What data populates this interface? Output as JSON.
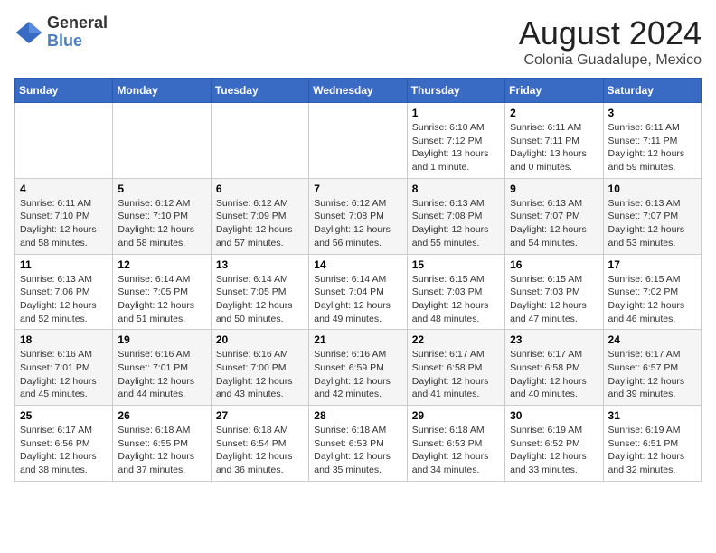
{
  "header": {
    "logo_general": "General",
    "logo_blue": "Blue",
    "month_year": "August 2024",
    "location": "Colonia Guadalupe, Mexico"
  },
  "weekdays": [
    "Sunday",
    "Monday",
    "Tuesday",
    "Wednesday",
    "Thursday",
    "Friday",
    "Saturday"
  ],
  "weeks": [
    [
      {
        "day": "",
        "info": ""
      },
      {
        "day": "",
        "info": ""
      },
      {
        "day": "",
        "info": ""
      },
      {
        "day": "",
        "info": ""
      },
      {
        "day": "1",
        "info": "Sunrise: 6:10 AM\nSunset: 7:12 PM\nDaylight: 13 hours\nand 1 minute."
      },
      {
        "day": "2",
        "info": "Sunrise: 6:11 AM\nSunset: 7:11 PM\nDaylight: 13 hours\nand 0 minutes."
      },
      {
        "day": "3",
        "info": "Sunrise: 6:11 AM\nSunset: 7:11 PM\nDaylight: 12 hours\nand 59 minutes."
      }
    ],
    [
      {
        "day": "4",
        "info": "Sunrise: 6:11 AM\nSunset: 7:10 PM\nDaylight: 12 hours\nand 58 minutes."
      },
      {
        "day": "5",
        "info": "Sunrise: 6:12 AM\nSunset: 7:10 PM\nDaylight: 12 hours\nand 58 minutes."
      },
      {
        "day": "6",
        "info": "Sunrise: 6:12 AM\nSunset: 7:09 PM\nDaylight: 12 hours\nand 57 minutes."
      },
      {
        "day": "7",
        "info": "Sunrise: 6:12 AM\nSunset: 7:08 PM\nDaylight: 12 hours\nand 56 minutes."
      },
      {
        "day": "8",
        "info": "Sunrise: 6:13 AM\nSunset: 7:08 PM\nDaylight: 12 hours\nand 55 minutes."
      },
      {
        "day": "9",
        "info": "Sunrise: 6:13 AM\nSunset: 7:07 PM\nDaylight: 12 hours\nand 54 minutes."
      },
      {
        "day": "10",
        "info": "Sunrise: 6:13 AM\nSunset: 7:07 PM\nDaylight: 12 hours\nand 53 minutes."
      }
    ],
    [
      {
        "day": "11",
        "info": "Sunrise: 6:13 AM\nSunset: 7:06 PM\nDaylight: 12 hours\nand 52 minutes."
      },
      {
        "day": "12",
        "info": "Sunrise: 6:14 AM\nSunset: 7:05 PM\nDaylight: 12 hours\nand 51 minutes."
      },
      {
        "day": "13",
        "info": "Sunrise: 6:14 AM\nSunset: 7:05 PM\nDaylight: 12 hours\nand 50 minutes."
      },
      {
        "day": "14",
        "info": "Sunrise: 6:14 AM\nSunset: 7:04 PM\nDaylight: 12 hours\nand 49 minutes."
      },
      {
        "day": "15",
        "info": "Sunrise: 6:15 AM\nSunset: 7:03 PM\nDaylight: 12 hours\nand 48 minutes."
      },
      {
        "day": "16",
        "info": "Sunrise: 6:15 AM\nSunset: 7:03 PM\nDaylight: 12 hours\nand 47 minutes."
      },
      {
        "day": "17",
        "info": "Sunrise: 6:15 AM\nSunset: 7:02 PM\nDaylight: 12 hours\nand 46 minutes."
      }
    ],
    [
      {
        "day": "18",
        "info": "Sunrise: 6:16 AM\nSunset: 7:01 PM\nDaylight: 12 hours\nand 45 minutes."
      },
      {
        "day": "19",
        "info": "Sunrise: 6:16 AM\nSunset: 7:01 PM\nDaylight: 12 hours\nand 44 minutes."
      },
      {
        "day": "20",
        "info": "Sunrise: 6:16 AM\nSunset: 7:00 PM\nDaylight: 12 hours\nand 43 minutes."
      },
      {
        "day": "21",
        "info": "Sunrise: 6:16 AM\nSunset: 6:59 PM\nDaylight: 12 hours\nand 42 minutes."
      },
      {
        "day": "22",
        "info": "Sunrise: 6:17 AM\nSunset: 6:58 PM\nDaylight: 12 hours\nand 41 minutes."
      },
      {
        "day": "23",
        "info": "Sunrise: 6:17 AM\nSunset: 6:58 PM\nDaylight: 12 hours\nand 40 minutes."
      },
      {
        "day": "24",
        "info": "Sunrise: 6:17 AM\nSunset: 6:57 PM\nDaylight: 12 hours\nand 39 minutes."
      }
    ],
    [
      {
        "day": "25",
        "info": "Sunrise: 6:17 AM\nSunset: 6:56 PM\nDaylight: 12 hours\nand 38 minutes."
      },
      {
        "day": "26",
        "info": "Sunrise: 6:18 AM\nSunset: 6:55 PM\nDaylight: 12 hours\nand 37 minutes."
      },
      {
        "day": "27",
        "info": "Sunrise: 6:18 AM\nSunset: 6:54 PM\nDaylight: 12 hours\nand 36 minutes."
      },
      {
        "day": "28",
        "info": "Sunrise: 6:18 AM\nSunset: 6:53 PM\nDaylight: 12 hours\nand 35 minutes."
      },
      {
        "day": "29",
        "info": "Sunrise: 6:18 AM\nSunset: 6:53 PM\nDaylight: 12 hours\nand 34 minutes."
      },
      {
        "day": "30",
        "info": "Sunrise: 6:19 AM\nSunset: 6:52 PM\nDaylight: 12 hours\nand 33 minutes."
      },
      {
        "day": "31",
        "info": "Sunrise: 6:19 AM\nSunset: 6:51 PM\nDaylight: 12 hours\nand 32 minutes."
      }
    ]
  ]
}
